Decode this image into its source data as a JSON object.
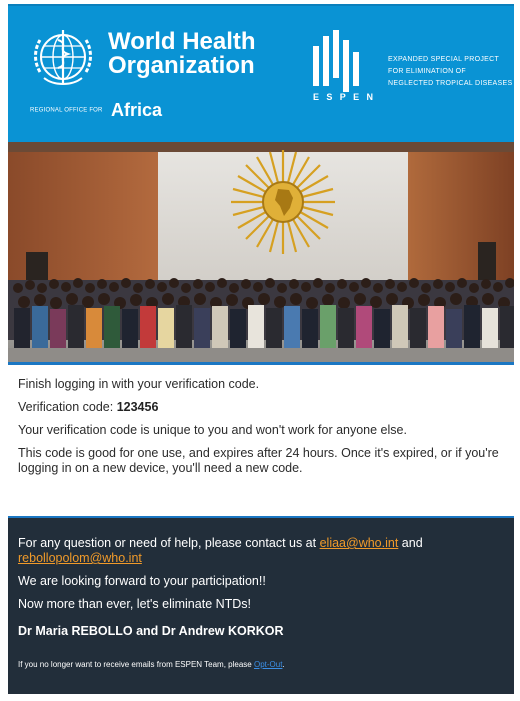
{
  "header": {
    "who_name_line1": "World Health",
    "who_name_line2": "Organization",
    "regional_prefix": "REGIONAL OFFICE FOR",
    "regional_region": "Africa",
    "espen_letters": [
      "E",
      "S",
      "P",
      "E",
      "N"
    ],
    "espen_desc_lines": [
      "EXPANDED SPECIAL PROJECT",
      "FOR ELIMINATION OF",
      "NEGLECTED TROPICAL DISEASES"
    ],
    "logo_icon": "who-emblem-icon",
    "espen_icon": "espen-bars-icon",
    "colors": {
      "banner": "#0a93d4",
      "footer": "#222e3a",
      "link": "#f09a2a",
      "optout_link": "#3b8fe6"
    }
  },
  "body": {
    "intro": "Finish logging in with your verification code.",
    "code_label": "Verification code:",
    "code_value": "123456",
    "unique": "Your verification code is unique to you and won't work for anyone else.",
    "expiry": "This code is good for one use, and expires after 24 hours. Once it's expired, or if you're logging in on a new device, you'll need a new code."
  },
  "footer": {
    "contact_text": "For any question or need of help, please contact us at",
    "email1": "eliaa@who.int",
    "and_text": "and",
    "email2": "rebollopolom@who.int",
    "looking_forward": "We are looking forward to your participation!!",
    "eliminate": "Now more than ever, let's eliminate NTDs!",
    "signers": "Dr Maria REBOLLO and Dr Andrew KORKOR",
    "optout_text": "If you no longer want to receive emails from ESPEN Team, please",
    "optout_link": "Opt-Out",
    "optout_end": "."
  }
}
